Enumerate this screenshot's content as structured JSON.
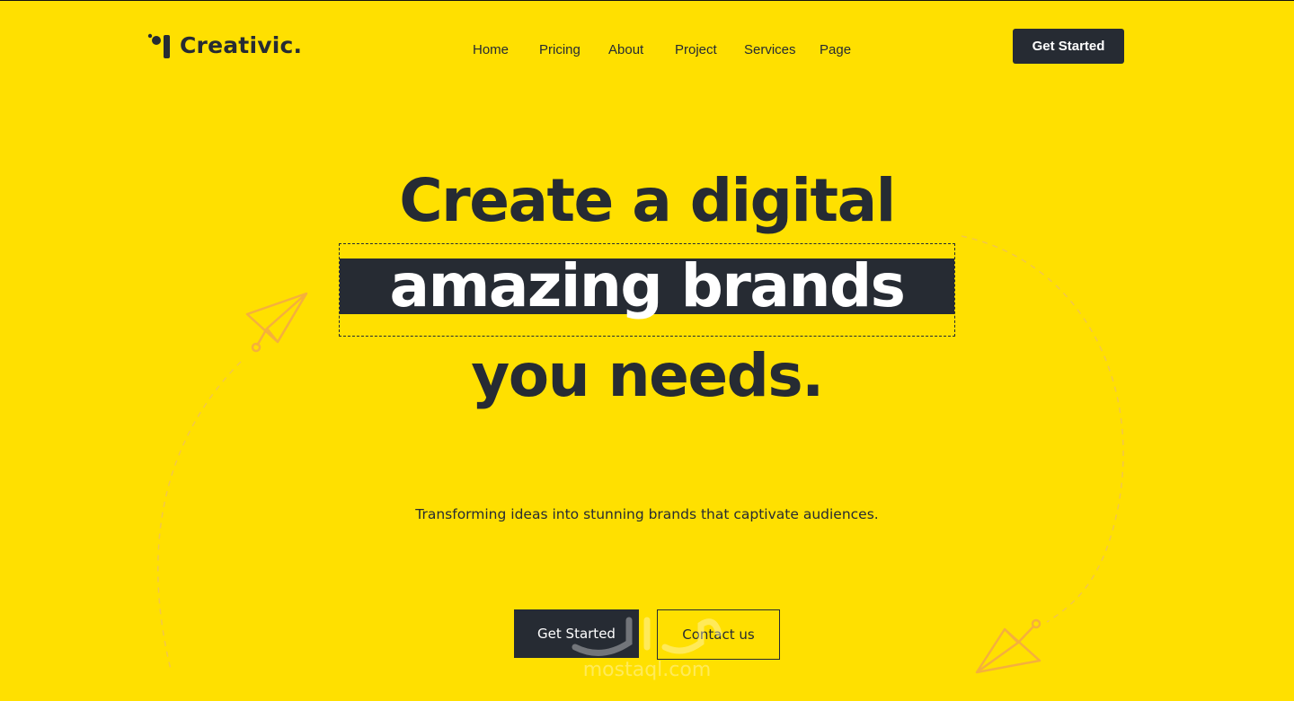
{
  "brand": {
    "name": "Creativic.",
    "logo_icon": "logo-mark-icon"
  },
  "nav": {
    "items": [
      {
        "label": "Home"
      },
      {
        "label": "Pricing"
      },
      {
        "label": "About"
      },
      {
        "label": "Project"
      },
      {
        "label": "Services"
      },
      {
        "label": "Page"
      }
    ],
    "cta_label": "Get Started"
  },
  "hero": {
    "line1": "Create a digital",
    "highlight": "amazing brands",
    "line3": "you needs.",
    "subtitle": "Transforming ideas into stunning brands that captivate audiences.",
    "primary_button": "Get Started",
    "secondary_button": "Contact us"
  },
  "decorations": {
    "left_icon": "paper-plane-icon",
    "right_icon": "paper-plane-icon"
  },
  "watermark": {
    "text": "mostaql.com"
  },
  "colors": {
    "background": "#ffe000",
    "dark": "#262b33",
    "accent": "#f5b83d",
    "white": "#ffffff"
  }
}
